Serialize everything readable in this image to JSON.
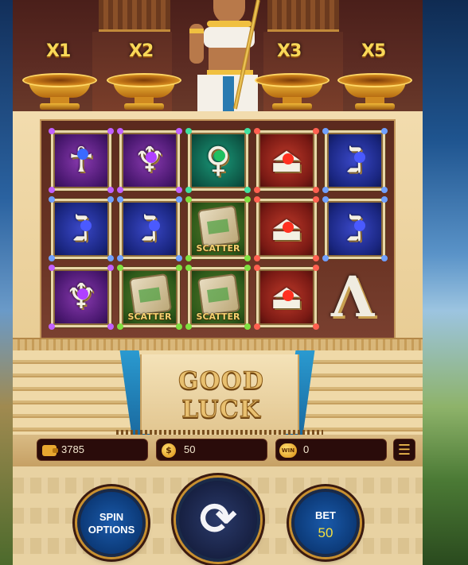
{
  "multipliers": [
    "X1",
    "X2",
    "X3",
    "X5"
  ],
  "reels": {
    "scatter_label": "SCATTER",
    "rows": [
      [
        "ankh-symbol",
        "ankh-symbol",
        "tyet-symbol",
        "weight-symbol",
        "eye-of-horus-symbol"
      ],
      [
        "eye-of-horus-symbol",
        "eye-of-horus-symbol",
        "scatter-scroll-symbol",
        "weight-symbol",
        "eye-of-horus-symbol"
      ],
      [
        "ankh-symbol",
        "scatter-scroll-symbol",
        "scatter-scroll-symbol",
        "weight-symbol",
        "letter-a-symbol"
      ]
    ]
  },
  "message": {
    "line1": "GOOD",
    "line2": "LUCK"
  },
  "infobar": {
    "balance": "3785",
    "bet": "50",
    "win_icon_label": "WIN",
    "coin_icon_label": "$",
    "win": "0"
  },
  "controls": {
    "spin_options_line1": "SPIN",
    "spin_options_line2": "OPTIONS",
    "bet_label": "BET",
    "bet_value": "50"
  },
  "colors": {
    "gold": "#f0c040",
    "bet_value": "#f4e040",
    "button_blue": "#1a5aaa"
  }
}
